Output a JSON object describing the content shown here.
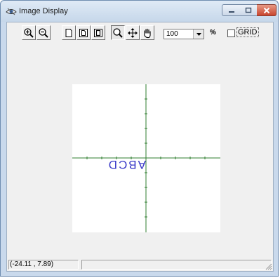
{
  "window": {
    "title": "Image Display",
    "app_icon": "eye-icon",
    "controls": [
      "minimize-icon",
      "maximize-icon",
      "close-icon"
    ]
  },
  "toolbar": {
    "buttons": [
      {
        "name": "zoom-in-button",
        "icon": "magnifier-plus-icon"
      },
      {
        "name": "zoom-out-button",
        "icon": "magnifier-minus-icon"
      },
      {
        "name": "page-button",
        "icon": "page-icon"
      },
      {
        "name": "page-frame-button",
        "icon": "page-frame-icon"
      },
      {
        "name": "page-fold-button",
        "icon": "page-fold-icon"
      },
      {
        "name": "zoom-tool-button",
        "icon": "magnifier-icon",
        "pressed": true
      },
      {
        "name": "move-tool-button",
        "icon": "four-arrows-icon"
      },
      {
        "name": "pan-tool-button",
        "icon": "hand-icon"
      }
    ],
    "zoom_value": "100",
    "zoom_unit": "%",
    "grid_label": "GRID",
    "grid_checked": false
  },
  "canvas": {
    "text": "ABCD",
    "text_color": "#3b3bc8",
    "axis_color": "#2f7d2f"
  },
  "status": {
    "coordinates": "(-24.11 , 7.89)",
    "secondary": ""
  },
  "colors": {
    "frame": "#c9d9ec",
    "client_bg": "#f0f0f0",
    "close_button": "#c8452e"
  }
}
